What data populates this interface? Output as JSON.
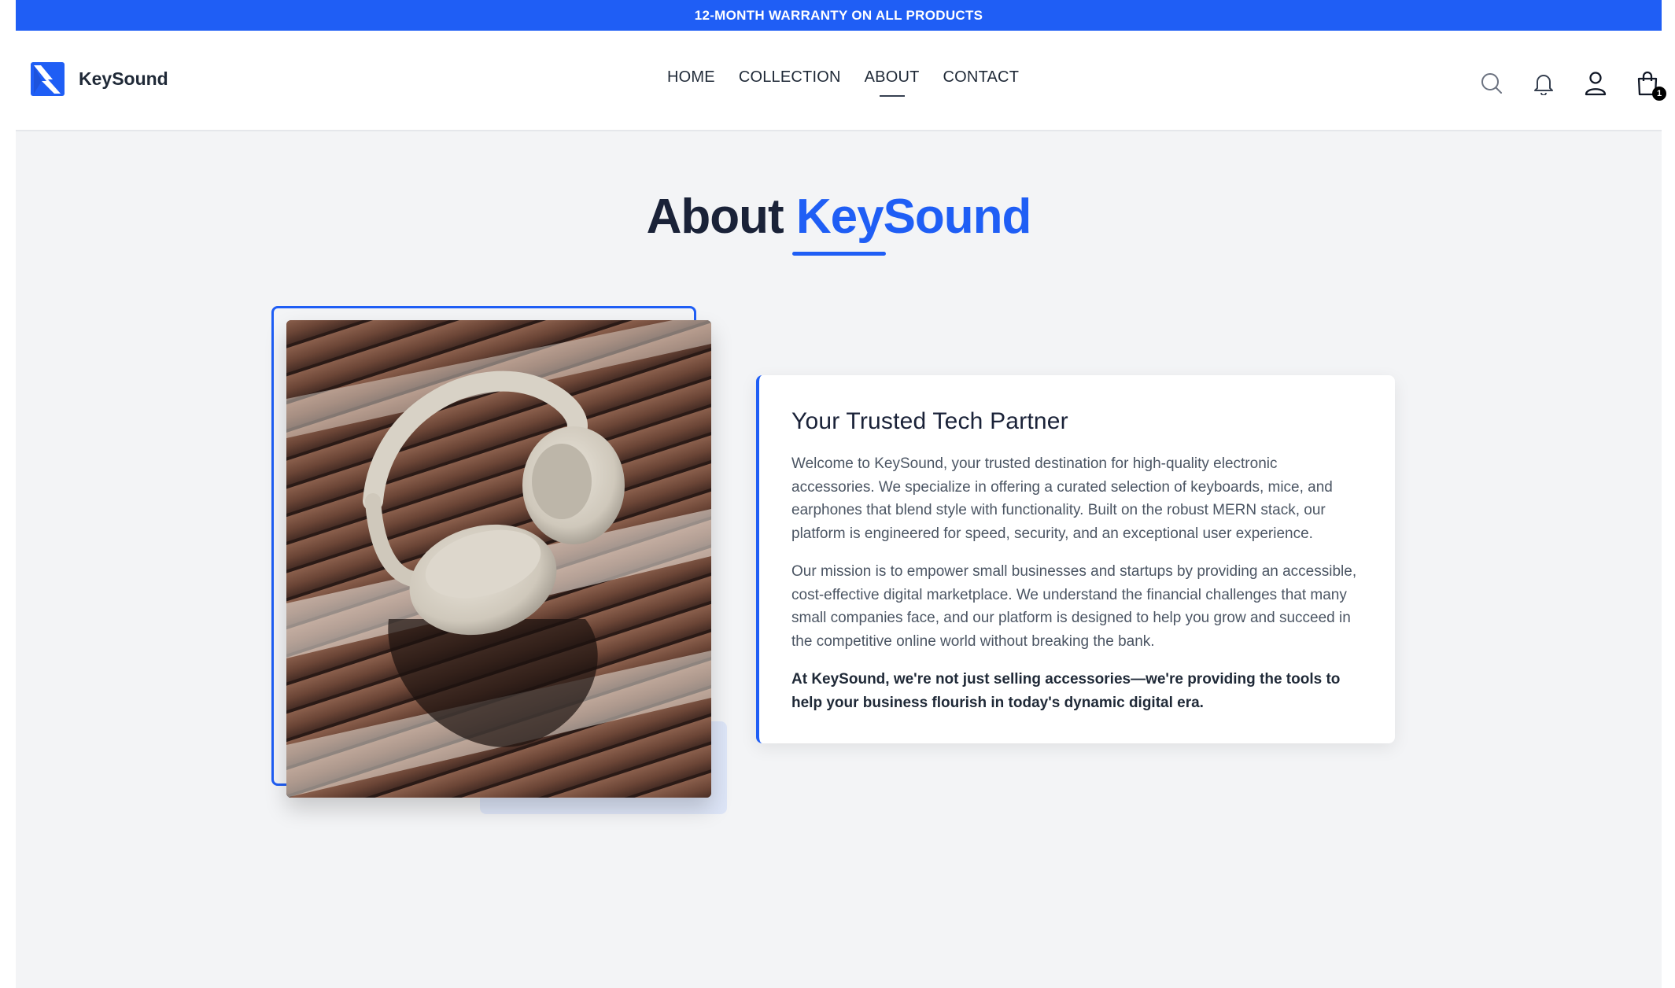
{
  "banner": {
    "text": "12-MONTH WARRANTY ON ALL PRODUCTS"
  },
  "brand": {
    "name": "KeySound",
    "accent_color": "#1f5ef5",
    "dark_color": "#1a2238"
  },
  "nav": {
    "items": [
      {
        "label": "HOME",
        "active": false
      },
      {
        "label": "COLLECTION",
        "active": false
      },
      {
        "label": "ABOUT",
        "active": true
      },
      {
        "label": "CONTACT",
        "active": false
      }
    ]
  },
  "header_icons": [
    "search-icon",
    "bell-icon",
    "user-icon",
    "shopping-bag-icon"
  ],
  "cart": {
    "count": "1"
  },
  "page_title": {
    "prefix": "About",
    "highlight": "KeySound"
  },
  "about": {
    "image": "headphones-photo",
    "heading": "Your Trusted Tech Partner",
    "paragraph_1": "Welcome to KeySound, your trusted destination for high-quality electronic accessories. We specialize in offering a curated selection of keyboards, mice, and earphones that blend style with functionality. Built on the robust MERN stack, our platform is engineered for speed, security, and an exceptional user experience.",
    "paragraph_2": "Our mission is to empower small businesses and startups by providing an accessible, cost-effective digital marketplace. We understand the financial challenges that many small companies face, and our platform is designed to help you grow and succeed in the competitive online world without breaking the bank.",
    "paragraph_3": "At KeySound, we're not just selling accessories—we're providing the tools to help your business flourish in today's dynamic digital era."
  }
}
